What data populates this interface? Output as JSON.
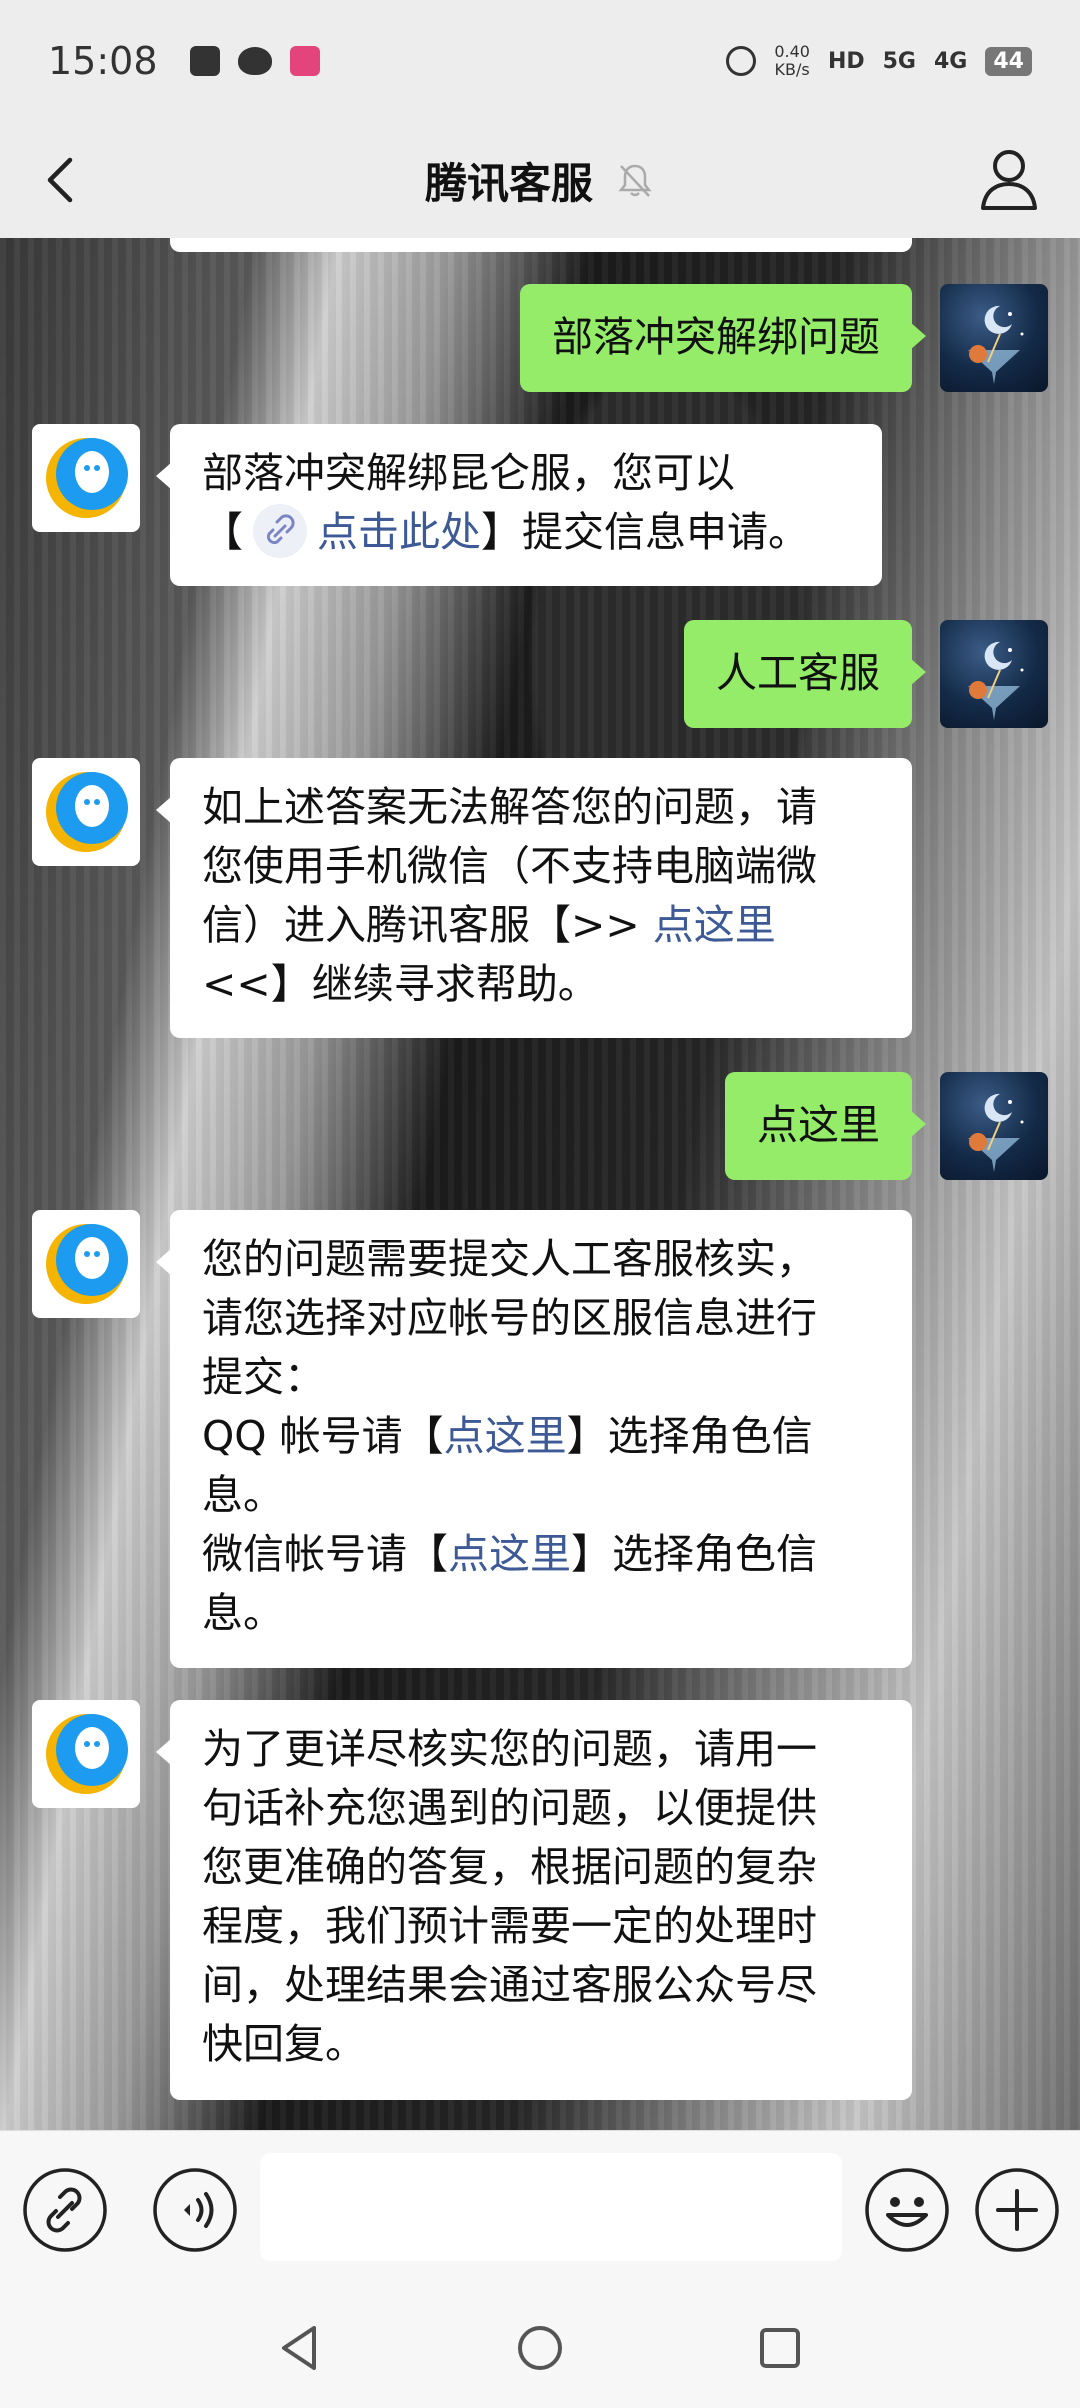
{
  "status_bar": {
    "time": "15:08",
    "net_speed_value": "0.40",
    "net_speed_unit": "KB/s",
    "hd_label": "HD",
    "sim1": "5G",
    "sim2": "4G",
    "battery": "44"
  },
  "nav": {
    "title": "腾讯客服"
  },
  "messages": [
    {
      "from": "me",
      "text": "部落冲突解绑问题"
    },
    {
      "from": "bot",
      "line1": "部落冲突解绑昆仑服，您可以",
      "line2_prefix": "【",
      "line2_link": "点击此处",
      "line2_suffix": "】提交信息申请。"
    },
    {
      "from": "me",
      "text": "人工客服"
    },
    {
      "from": "bot",
      "line1": "如上述答案无法解答您的问题，请",
      "line2": "您使用手机微信（不支持电脑端微",
      "line3_prefix": "信）进入腾讯客服【>> ",
      "line3_link": "点这里",
      "line4": "<<】继续寻求帮助。"
    },
    {
      "from": "me",
      "text": "点这里"
    },
    {
      "from": "bot",
      "line1": "您的问题需要提交人工客服核实，",
      "line2": "请您选择对应帐号的区服信息进行",
      "line3": "提交：",
      "line4_prefix": "QQ 帐号请【",
      "line4_link": "点这里",
      "line4_suffix": "】选择角色信",
      "line5": "息。",
      "line6_prefix": "微信帐号请【",
      "line6_link": "点这里",
      "line6_suffix": "】选择角色信",
      "line7": "息。"
    },
    {
      "from": "bot",
      "line1": "为了更详尽核实您的问题，请用一",
      "line2": "句话补充您遇到的问题，以便提供",
      "line3": "您更准确的答复，根据问题的复杂",
      "line4": "程度，我们预计需要一定的处理时",
      "line5": "间，处理结果会通过客服公众号尽",
      "line6": "快回复。"
    }
  ],
  "colors": {
    "my_bubble": "#95ec69",
    "bot_bubble": "#ffffff",
    "link": "#3d5a96",
    "bot_avatar_blue": "#1c9bf0",
    "bot_avatar_yellow": "#f4b400"
  },
  "icons": {
    "input_left_1": "link-icon",
    "input_left_2": "voice-icon",
    "input_right_1": "emoji-icon",
    "input_right_2": "plus-icon"
  }
}
